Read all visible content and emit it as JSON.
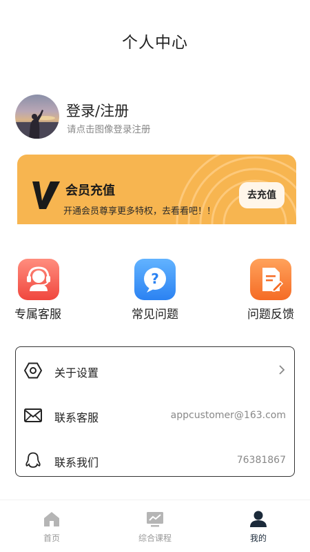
{
  "header": {
    "title": "个人中心"
  },
  "profile": {
    "title": "登录/注册",
    "subtitle": "请点击图像登录注册"
  },
  "vip": {
    "logo_letter": "V",
    "title": "会员充值",
    "description": "开通会员尊享更多特权，去看看吧！！",
    "button_label": "去充值",
    "color": "#f7b550"
  },
  "shortcuts": [
    {
      "label": "专属客服",
      "icon": "headset-agent-icon",
      "color": "#f0473e"
    },
    {
      "label": "常见问题",
      "icon": "question-bubble-icon",
      "color": "#2b82f2"
    },
    {
      "label": "问题反馈",
      "icon": "document-edit-icon",
      "color": "#f56b25"
    }
  ],
  "menu": {
    "rows": [
      {
        "label": "关于设置",
        "icon": "hexagon-gear-icon",
        "value": ""
      },
      {
        "label": "联系客服",
        "icon": "mail-icon",
        "value": "appcustomer@163.com"
      },
      {
        "label": "联系我们",
        "icon": "qq-penguin-icon",
        "value": "76381867"
      }
    ]
  },
  "tabbar": {
    "items": [
      {
        "label": "首页",
        "icon": "home-icon",
        "active": false
      },
      {
        "label": "综合课程",
        "icon": "chart-monitor-icon",
        "active": false
      },
      {
        "label": "我的",
        "icon": "user-icon",
        "active": true
      }
    ],
    "active_color": "#1b2a3a",
    "inactive_color": "#999999"
  }
}
